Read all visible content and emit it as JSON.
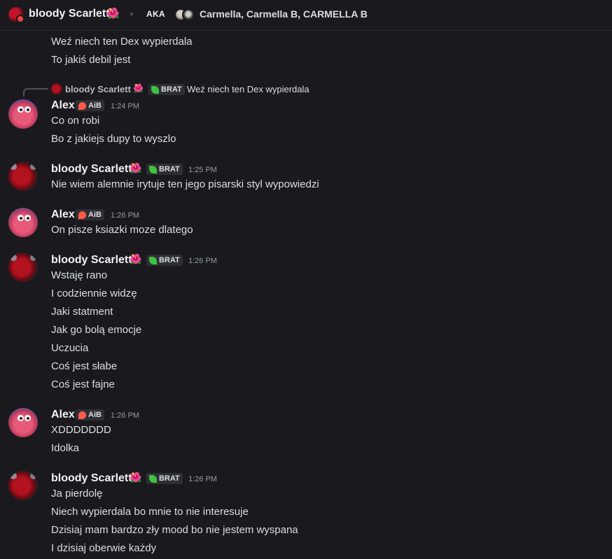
{
  "header": {
    "name": "bloody Scarlett",
    "flower": "🌺",
    "aka_label": "AKA",
    "aka_names": "Carmella, Carmella B, CARMELLA B"
  },
  "top_lines": [
    "Weź niech ten Dex wypierdala",
    "To jakiś debil jest"
  ],
  "reply": {
    "name": "bloody Scarlett",
    "flower": "🌺",
    "tag": "BRAT",
    "text": "Weź niech ten Dex wypierdala"
  },
  "messages": [
    {
      "user": "Alex",
      "tag": "AiB",
      "time": "1:24 PM",
      "lines": [
        "Co on robi",
        "Bo z jakiejs dupy to wyszlo"
      ]
    },
    {
      "user": "bloody Scarlett",
      "flower": "🌺",
      "tag": "BRAT",
      "time": "1:25 PM",
      "lines": [
        "Nie wiem alemnie irytuje ten jego pisarski styl wypowiedzi"
      ]
    },
    {
      "user": "Alex",
      "tag": "AiB",
      "time": "1:26 PM",
      "lines": [
        "On pisze ksiazki moze dlatego"
      ]
    },
    {
      "user": "bloody Scarlett",
      "flower": "🌺",
      "tag": "BRAT",
      "time": "1:26 PM",
      "lines": [
        "Wstaję rano",
        "I codziennie widzę",
        "Jaki statment",
        "Jak go bolą emocje",
        "Uczucia",
        "Coś jest słabe",
        "Coś jest fajne"
      ]
    },
    {
      "user": "Alex",
      "tag": "AiB",
      "time": "1:26 PM",
      "lines": [
        "XDDDDDDD",
        "Idolka"
      ]
    },
    {
      "user": "bloody Scarlett",
      "flower": "🌺",
      "tag": "BRAT",
      "time": "1:26 PM",
      "lines": [
        "Ja pierdolę",
        "Niech wypierdala bo mnie to nie interesuje",
        "Dzisiaj mam bardzo zły mood bo nie jestem wyspana",
        "I dzisiaj oberwie każdy"
      ]
    }
  ]
}
